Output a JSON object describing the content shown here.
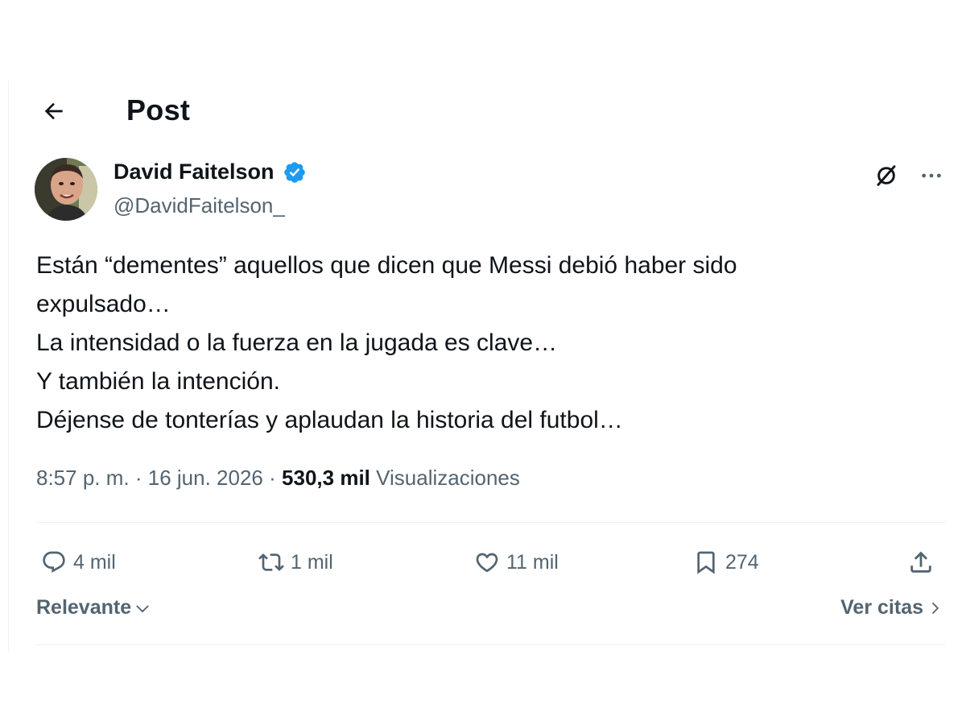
{
  "header": {
    "title": "Post",
    "back_icon": "arrow-left-icon"
  },
  "author": {
    "name": "David Faitelson",
    "handle": "@DavidFaitelson_",
    "verified_color": "#1d9bf0"
  },
  "post": {
    "lines": [
      "Están “dementes” aquellos que dicen que Messi debió haber sido",
      "expulsado…",
      "La intensidad o la fuerza en la jugada es clave…",
      "Y también la intención.",
      "Déjense de tonterías y aplaudan la historia del futbol…"
    ],
    "time": "8:57 p. m.",
    "separator": "·",
    "date": "16 jun. 2026",
    "views_count": "530,3 mil",
    "views_label": "Visualizaciones"
  },
  "actions": {
    "replies": "4 mil",
    "reposts": "1 mil",
    "likes": "11 mil",
    "bookmarks": "274"
  },
  "footer": {
    "sort_label": "Relevante",
    "quotes_label": "Ver citas"
  },
  "colors": {
    "text": "#0f1419",
    "muted": "#536471",
    "accent": "#1d9bf0",
    "divider": "#eff3f4"
  }
}
